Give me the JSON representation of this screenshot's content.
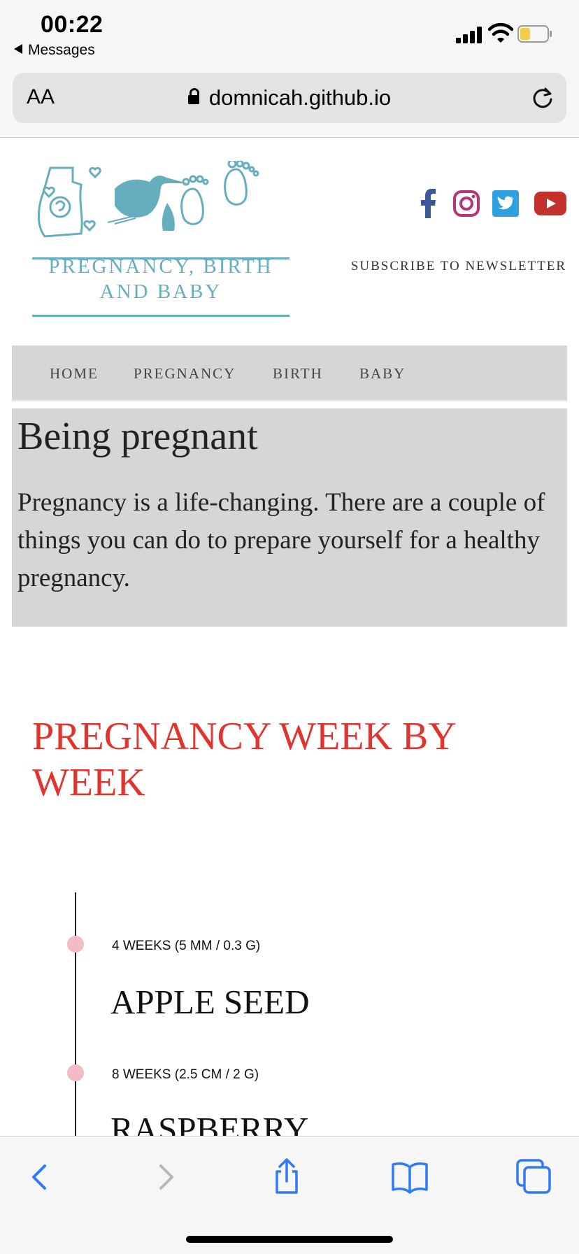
{
  "status_bar": {
    "time": "00:22",
    "back_app": "Messages"
  },
  "browser": {
    "text_size_label": "AA",
    "url": "domnicah.github.io"
  },
  "logo": {
    "line1": "PREGNANCY, BIRTH",
    "line2": "AND BABY"
  },
  "social": [
    "facebook",
    "instagram",
    "twitter",
    "youtube"
  ],
  "subscribe_label": "SUBSCRIBE TO NEWSLETTER",
  "nav": [
    "HOME",
    "PREGNANCY",
    "BIRTH",
    "BABY"
  ],
  "hero": {
    "title": "Being pregnant",
    "text": "Pregnancy is a life-changing. There are a couple of things you can do to prepare yourself for a healthy pregnancy."
  },
  "section_title": "PREGNANCY WEEK BY WEEK",
  "timeline": [
    {
      "size": "4 WEEKS (5 MM / 0.3 G)",
      "fruit": "APPLE SEED"
    },
    {
      "size": "8 WEEKS (2.5 CM / 2 G)",
      "fruit": "RASPBERRY"
    }
  ],
  "colors": {
    "accent_teal": "#66aebf",
    "heading_red": "#e0352f",
    "nav_bg": "#d6d6d6",
    "ios_blue": "#2f7bf6",
    "dot_pink": "#f3bcc4"
  }
}
